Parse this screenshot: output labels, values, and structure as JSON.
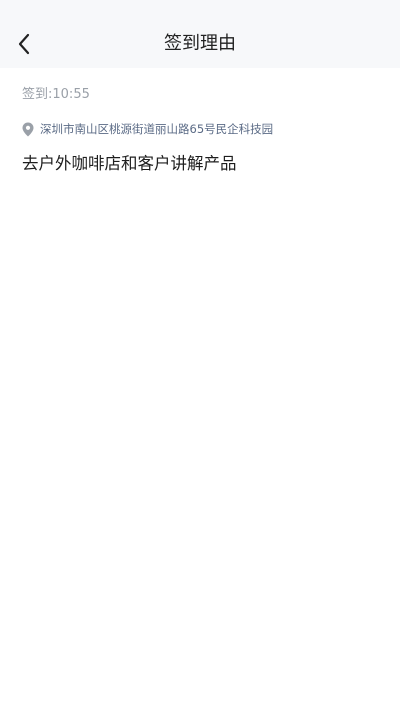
{
  "header": {
    "title": "签到理由"
  },
  "checkin": {
    "label": "签到:",
    "time": "10:55"
  },
  "location": {
    "address": "深圳市南山区桃源街道丽山路65号民企科技园"
  },
  "reason": {
    "text": "去户外咖啡店和客户讲解产品"
  },
  "colors": {
    "nav_background": "#f7f8fa",
    "muted_text": "#9aa0a8",
    "location_text": "#5b6b86",
    "body_text": "#1e1e1e"
  }
}
